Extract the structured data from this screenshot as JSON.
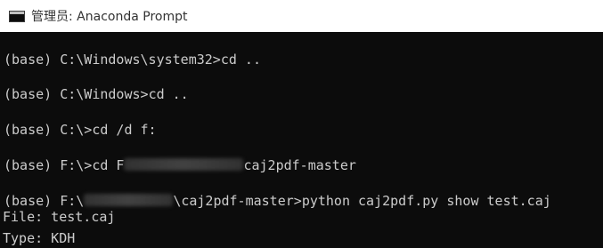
{
  "window": {
    "title": "管理员: Anaconda Prompt"
  },
  "console": {
    "lines": [
      {
        "prompt": "(base) C:\\Windows\\system32>",
        "command": "cd .."
      },
      {
        "prompt": "(base) C:\\Windows>",
        "command": "cd .."
      },
      {
        "prompt": "(base) C:\\>",
        "command": "cd /d f:"
      },
      {
        "prompt": "(base) F:\\>",
        "command_prefix": "cd F",
        "command_suffix": "caj2pdf-master"
      },
      {
        "prompt_prefix": "(base) F:\\",
        "prompt_suffix": "\\caj2pdf-master>",
        "command": "python caj2pdf.py show test.caj"
      }
    ],
    "output": [
      "File: test.caj",
      "Type: KDH"
    ]
  }
}
